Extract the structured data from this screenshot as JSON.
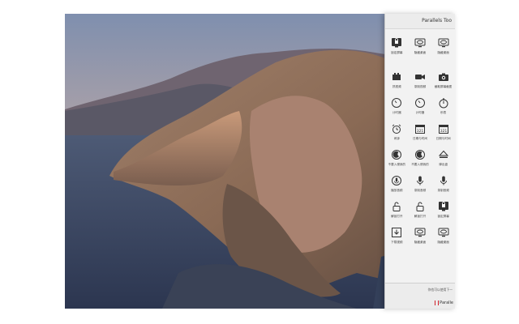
{
  "panel": {
    "title": "Parallels Too",
    "footer_text": "你也可以使用下一",
    "brand": "Paralle",
    "sections": [
      {
        "header": "",
        "tools": [
          {
            "label": "锁定屏幕",
            "icon": "lock-screen-icon"
          },
          {
            "label": "隐藏桌面",
            "icon": "display-eye-icon"
          },
          {
            "label": "隐藏桌面",
            "icon": "display-eye-icon"
          }
        ]
      },
      {
        "header": "",
        "tools": [
          {
            "label": "抓视频",
            "icon": "camera-icon"
          },
          {
            "label": "录制视频",
            "icon": "video-camera-icon"
          },
          {
            "label": "截取屏幕截图",
            "icon": "photo-camera-icon"
          },
          {
            "label": "计时器",
            "icon": "timer-icon"
          },
          {
            "label": "计时器",
            "icon": "timer-icon"
          },
          {
            "label": "秒表",
            "icon": "stopwatch-icon"
          },
          {
            "label": "闹钟",
            "icon": "alarm-clock-icon"
          },
          {
            "label": "日期与时间",
            "icon": "calendar-icon"
          },
          {
            "label": "日期与时间",
            "icon": "calendar-icon"
          },
          {
            "label": "不要入侵我的",
            "icon": "do-not-sleep-icon"
          },
          {
            "label": "不要入侵我的",
            "icon": "do-not-sleep-icon"
          },
          {
            "label": "弹出盘",
            "icon": "eject-icon"
          },
          {
            "label": "播放音频",
            "icon": "microphone-off-icon"
          },
          {
            "label": "录制音频",
            "icon": "microphone-icon"
          },
          {
            "label": "录制音频",
            "icon": "microphone-icon"
          },
          {
            "label": "解锁打开",
            "icon": "unlock-icon"
          },
          {
            "label": "解锁打开",
            "icon": "unlock-icon"
          },
          {
            "label": "锁定屏幕",
            "icon": "lock-screen-icon"
          },
          {
            "label": "下载视频",
            "icon": "download-icon"
          },
          {
            "label": "隐藏桌面",
            "icon": "display-eye-icon"
          },
          {
            "label": "隐藏桌面",
            "icon": "display-eye-icon"
          }
        ]
      },
      {
        "header": "",
        "tools": []
      }
    ]
  }
}
